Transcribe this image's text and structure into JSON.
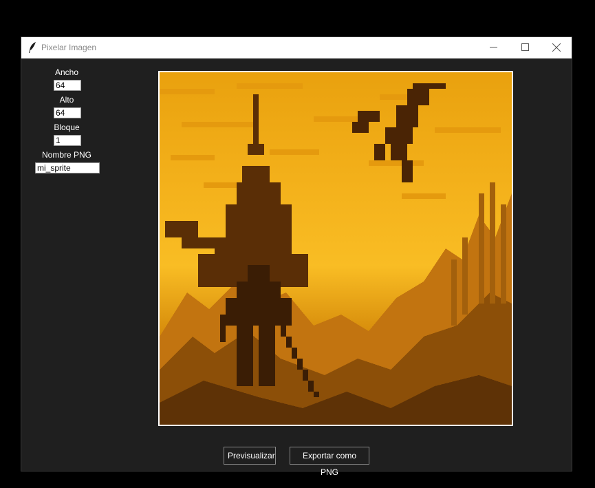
{
  "window": {
    "title": "Pixelar Imagen"
  },
  "form": {
    "width_label": "Ancho",
    "width_value": "64",
    "height_label": "Alto",
    "height_value": "64",
    "block_label": "Bloque",
    "block_value": "1",
    "name_label": "Nombre PNG",
    "name_value": "mi_sprite"
  },
  "actions": {
    "preview_label": "Previsualizar",
    "export_label": "Exportar como PNG"
  },
  "icons": {
    "app": "feather-icon",
    "minimize": "minimize-icon",
    "maximize": "maximize-icon",
    "close": "close-icon"
  },
  "colors": {
    "window_bg": "#1f1f1f",
    "sky_light": "#f6b41a",
    "sky_mid": "#e79a0c",
    "earth": "#b86a08",
    "silhouette": "#3a1d05",
    "shadow": "#5e3206"
  }
}
